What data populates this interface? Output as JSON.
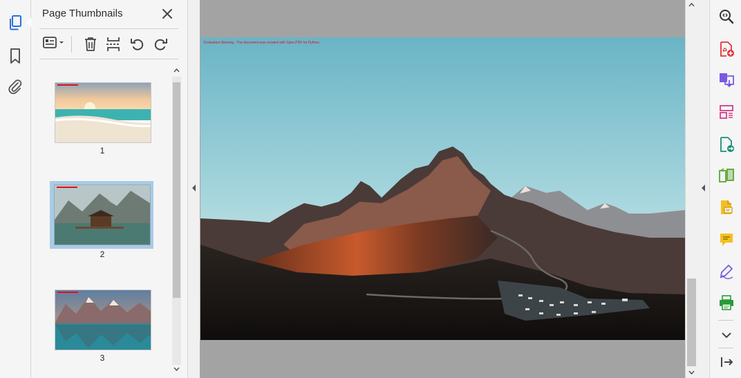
{
  "panel": {
    "title": "Page Thumbnails",
    "close_icon": "close-icon",
    "tools": [
      "thumbnail-options-icon",
      "delete-page-icon",
      "extract-pages-icon",
      "rotate-counterclockwise-icon",
      "rotate-clockwise-icon"
    ]
  },
  "left_rail": {
    "icons": [
      "page-thumbnails-icon",
      "bookmark-icon",
      "attachment-icon"
    ]
  },
  "thumbnails": [
    {
      "page": "1",
      "selected": false,
      "scene": "beach sunset"
    },
    {
      "page": "2",
      "selected": true,
      "scene": "lake cabin mountains"
    },
    {
      "page": "3",
      "selected": false,
      "scene": "mountain lake reflection"
    }
  ],
  "document": {
    "watermark": "Evaluation Warning : The document was created with Spire.PDF for Python.",
    "current_page": 2
  },
  "right_rail": {
    "icons": [
      "zoom-icon",
      "create-pdf-icon",
      "export-pdf-icon",
      "organize-pages-icon",
      "combine-files-icon",
      "compare-icon",
      "comment-file-icon",
      "comment-icon",
      "fill-sign-icon",
      "print-production-icon",
      "chevron-down-icon",
      "collapse-panel-icon"
    ]
  },
  "colors": {
    "accent_blue": "#2a6fdb",
    "selection": "#a9cbe6",
    "watermark_red": "#e0101a"
  }
}
